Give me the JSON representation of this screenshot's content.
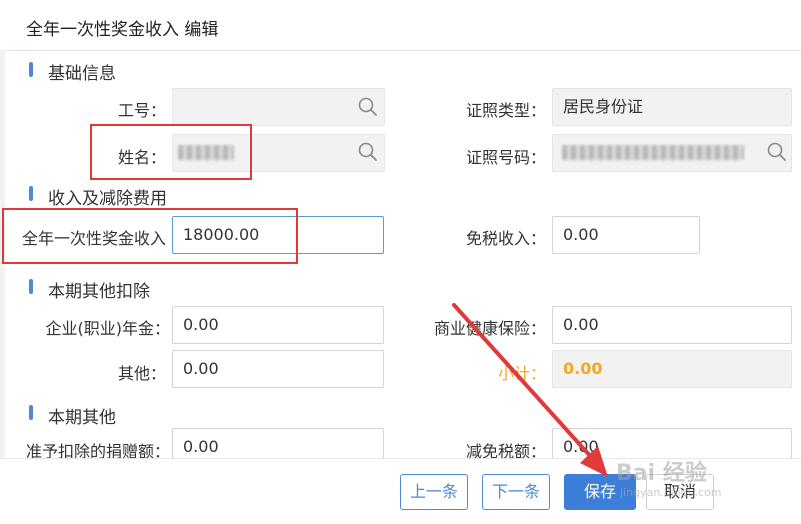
{
  "dialog": {
    "title": "全年一次性奖金收入 编辑"
  },
  "sections": {
    "basic": "基础信息",
    "income": "收入及减除费用",
    "other_deduction": "本期其他扣除",
    "other": "本期其他"
  },
  "basic_info": {
    "employee_id_label": "工号：",
    "employee_id_value": "",
    "name_label": "姓名：",
    "id_type_label": "证照类型：",
    "id_type_value": "居民身份证",
    "id_number_label": "证照号码："
  },
  "income": {
    "bonus_label": "全年一次性奖金收入",
    "bonus_value": "18000.00",
    "tax_free_label": "免税收入：",
    "tax_free_value": "0.00"
  },
  "other_deduction": {
    "annuity_label": "企业(职业)年金：",
    "annuity_value": "0.00",
    "health_insurance_label": "商业健康保险：",
    "health_insurance_value": "0.00",
    "other_label": "其他：",
    "other_value": "0.00",
    "subtotal_label": "小计：",
    "subtotal_value": "0.00"
  },
  "other": {
    "donation_label": "准予扣除的捐赠额：",
    "donation_value": "0.00",
    "tax_reduction_label": "减免税额：",
    "tax_reduction_value": "0.00"
  },
  "footer": {
    "prev_label": "上一条",
    "next_label": "下一条",
    "save_label": "保存",
    "cancel_label": "取消"
  },
  "watermark": {
    "main": "Bai 经验",
    "sub": "jingyan.baidu.com"
  },
  "colors": {
    "accent": "#3d7ed8",
    "section_marker": "#4f89d6",
    "highlight_box": "#e03a3a",
    "subtotal": "#f5a623"
  }
}
